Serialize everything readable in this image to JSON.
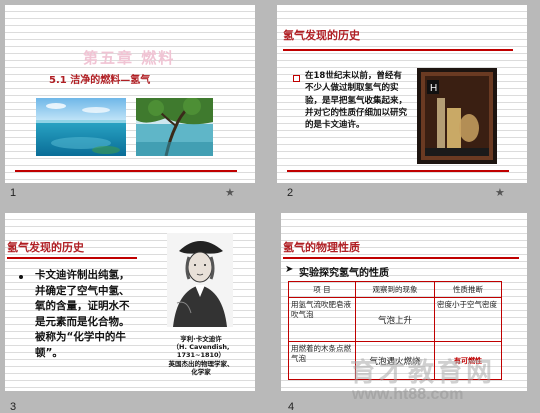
{
  "slides": [
    {
      "number": "1",
      "chapter_title": "第五章 燃料",
      "section_title": "5.1 洁净的燃料—氢气"
    },
    {
      "number": "2",
      "title": "氢气发现的历史",
      "bullet": "在18世纪末以前，曾经有不少人做过制取氢气的实验，是早把氢气收集起来，并对它的性质仔细加以研究的是卡文迪许。",
      "image_letter": "H"
    },
    {
      "number": "3",
      "title": "氢气发现的历史",
      "bullet": "卡文迪许制出纯氢，并确定了空气中氢、氧的含量，证明水不是元素而是化合物。被称为“化学中的牛顿”。",
      "caption_lines": [
        "亨利·卡文迪许",
        "（H. Cavendish,",
        "1731~1810）",
        "英国杰出的物理学家、",
        "化学家"
      ]
    },
    {
      "number": "4",
      "title": "氢气的物理性质",
      "subtitle": "实验探究氢气的性质",
      "table": {
        "headers": [
          "项  目",
          "观察到的现象",
          "性质推断"
        ],
        "rows": [
          [
            "用氢气流吹肥皂液吹气泡",
            "气泡上升",
            "密度小于空气密度"
          ],
          [
            "用燃着的木条点燃气泡",
            "气泡遇火燃烧",
            "有可燃性"
          ]
        ]
      }
    }
  ],
  "watermark": {
    "main": "育才教育网",
    "url": "www.ht88.com"
  }
}
